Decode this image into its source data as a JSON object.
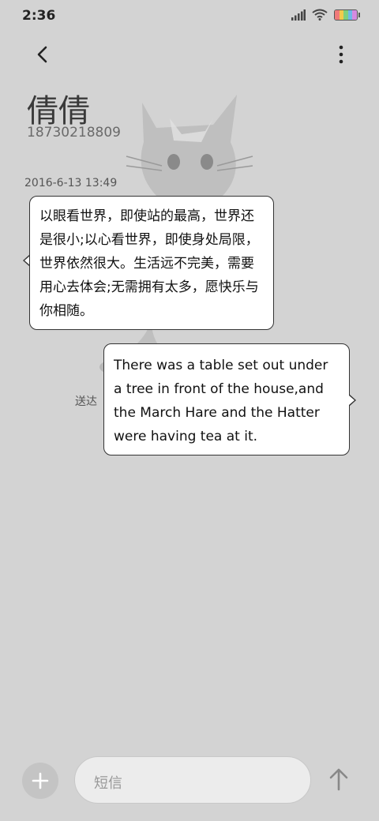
{
  "status_bar": {
    "time": "2:36",
    "icons": [
      "signal-icon",
      "wifi-icon",
      "battery-icon"
    ]
  },
  "header": {
    "back_icon": "chevron-left-icon",
    "menu_icon": "more-vertical-icon"
  },
  "contact": {
    "name": "倩倩",
    "number": "18730218809"
  },
  "conversation": {
    "timestamp": "2016-6-13 13:49",
    "incoming_message": "以眼看世界，即使站的最高，世界还是很小;以心看世界，即使身处局限，世界依然很大。生活远不完美，需要用心去体会;无需拥有太多，愿快乐与你相随。",
    "outgoing_message": "There was a table set out under a tree in front of the house,and the March Hare and the Hatter were having tea at it.",
    "delivered_status": "送达"
  },
  "composer": {
    "placeholder": "短信",
    "add_icon": "plus-icon",
    "send_icon": "arrow-up-icon"
  },
  "colors": {
    "background": "#d3d3d3",
    "bubble": "#ffffff",
    "bubble_border": "#333333"
  }
}
